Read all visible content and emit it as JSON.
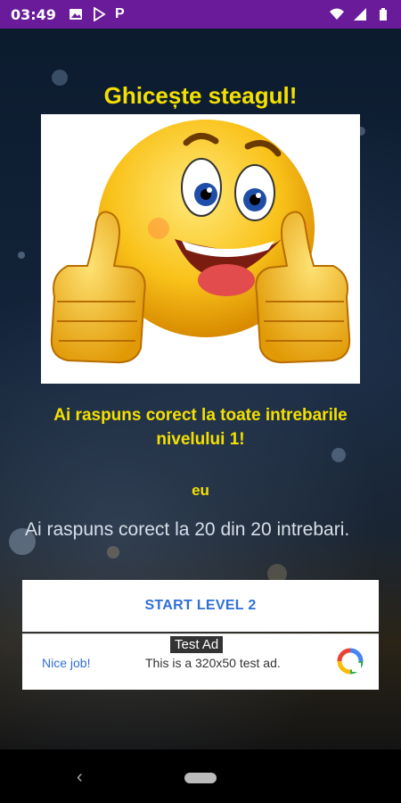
{
  "status": {
    "time": "03:49",
    "icons": [
      "image-icon",
      "play-store-icon",
      "p-icon",
      "wifi-icon",
      "signal-icon",
      "battery-icon"
    ],
    "p_glyph": "P"
  },
  "header": {
    "title": "Ghicește steagul!"
  },
  "main": {
    "image": "smiley-thumbs-up",
    "message": "Ai raspuns corect la toate intrebarile nivelului 1!",
    "player": "eu",
    "score": "Ai raspuns corect la 20 din 20 intrebari.",
    "start_button": "START LEVEL 2"
  },
  "ad": {
    "badge": "Test Ad",
    "nice": "Nice job!",
    "text": "This is a 320x50 test ad."
  },
  "colors": {
    "status_bar": "#6a1b9a",
    "title_yellow": "#f4e000",
    "link_blue": "#2f6fd6"
  }
}
